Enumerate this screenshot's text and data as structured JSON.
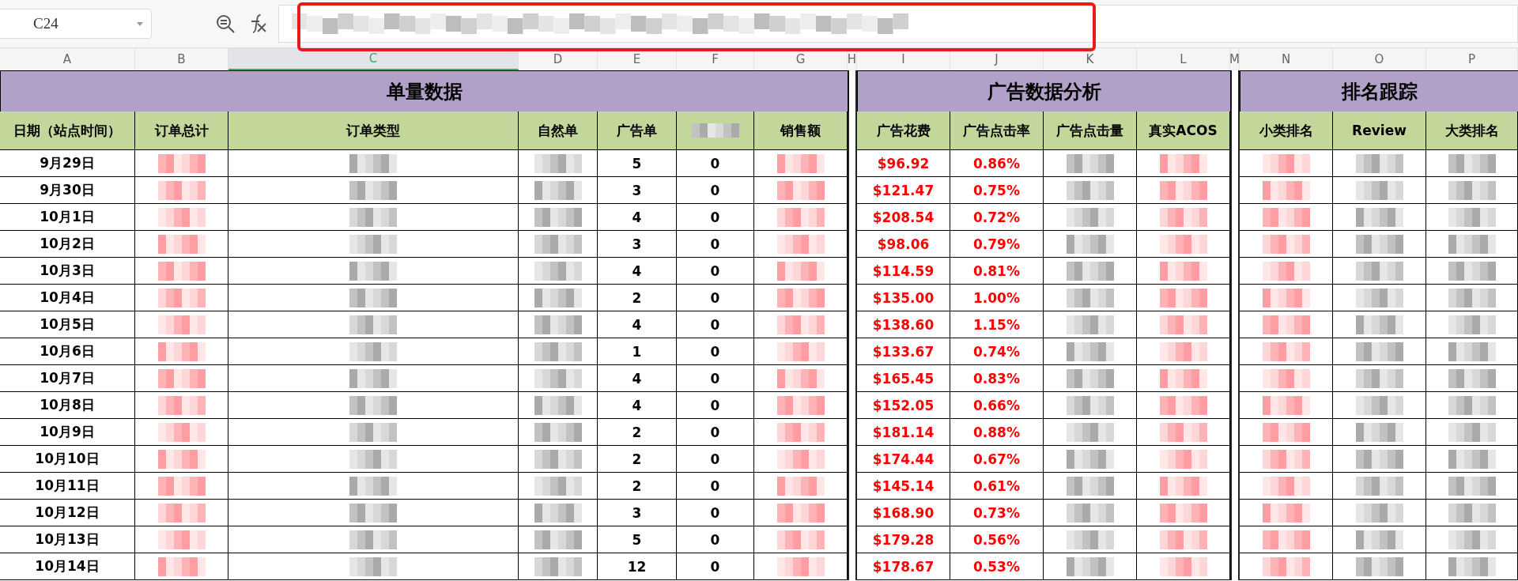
{
  "name_box": {
    "value": "C24"
  },
  "column_letters": [
    {
      "label": "A",
      "selected": false
    },
    {
      "label": "B",
      "selected": false
    },
    {
      "label": "C",
      "selected": true
    },
    {
      "label": "D",
      "selected": false
    },
    {
      "label": "E",
      "selected": false
    },
    {
      "label": "F",
      "selected": false
    },
    {
      "label": "G",
      "selected": false
    },
    {
      "label": "H",
      "selected": false
    },
    {
      "label": "I",
      "selected": false
    },
    {
      "label": "J",
      "selected": false
    },
    {
      "label": "K",
      "selected": false
    },
    {
      "label": "L",
      "selected": false
    },
    {
      "label": "M",
      "selected": false
    },
    {
      "label": "N",
      "selected": false
    },
    {
      "label": "O",
      "selected": false
    },
    {
      "label": "P",
      "selected": false
    }
  ],
  "sections": [
    {
      "title": "单量数据"
    },
    {
      "title": "广告数据分析"
    },
    {
      "title": "排名跟踪"
    }
  ],
  "headers": [
    {
      "label": "日期（站点时间）"
    },
    {
      "label": "订单总计"
    },
    {
      "label": "订单类型"
    },
    {
      "label": "自然单"
    },
    {
      "label": "广告单"
    },
    {
      "kind": "redacted"
    },
    {
      "label": "销售额"
    },
    {
      "label": "广告花费"
    },
    {
      "label": "广告点击率"
    },
    {
      "label": "广告点击量"
    },
    {
      "label": "真实ACOS"
    },
    {
      "label": "小类排名"
    },
    {
      "label": "Review"
    },
    {
      "label": "大类排名"
    }
  ],
  "rows": [
    {
      "date": "9月29日",
      "ad_orders": "5",
      "column_6": "0",
      "ad_spend": "$96.92",
      "ctr": "0.86%"
    },
    {
      "date": "9月30日",
      "ad_orders": "3",
      "column_6": "0",
      "ad_spend": "$121.47",
      "ctr": "0.75%"
    },
    {
      "date": "10月1日",
      "ad_orders": "4",
      "column_6": "0",
      "ad_spend": "$208.54",
      "ctr": "0.72%"
    },
    {
      "date": "10月2日",
      "ad_orders": "3",
      "column_6": "0",
      "ad_spend": "$98.06",
      "ctr": "0.79%"
    },
    {
      "date": "10月3日",
      "ad_orders": "4",
      "column_6": "0",
      "ad_spend": "$114.59",
      "ctr": "0.81%"
    },
    {
      "date": "10月4日",
      "ad_orders": "2",
      "column_6": "0",
      "ad_spend": "$135.00",
      "ctr": "1.00%"
    },
    {
      "date": "10月5日",
      "ad_orders": "4",
      "column_6": "0",
      "ad_spend": "$138.60",
      "ctr": "1.15%"
    },
    {
      "date": "10月6日",
      "ad_orders": "1",
      "column_6": "0",
      "ad_spend": "$133.67",
      "ctr": "0.74%"
    },
    {
      "date": "10月7日",
      "ad_orders": "4",
      "column_6": "0",
      "ad_spend": "$165.45",
      "ctr": "0.83%"
    },
    {
      "date": "10月8日",
      "ad_orders": "4",
      "column_6": "0",
      "ad_spend": "$152.05",
      "ctr": "0.66%"
    },
    {
      "date": "10月9日",
      "ad_orders": "2",
      "column_6": "0",
      "ad_spend": "$181.14",
      "ctr": "0.88%"
    },
    {
      "date": "10月10日",
      "ad_orders": "2",
      "column_6": "0",
      "ad_spend": "$174.44",
      "ctr": "0.67%"
    },
    {
      "date": "10月11日",
      "ad_orders": "2",
      "column_6": "0",
      "ad_spend": "$145.14",
      "ctr": "0.61%"
    },
    {
      "date": "10月12日",
      "ad_orders": "3",
      "column_6": "0",
      "ad_spend": "$168.90",
      "ctr": "0.73%"
    },
    {
      "date": "10月13日",
      "ad_orders": "5",
      "column_6": "0",
      "ad_spend": "$179.28",
      "ctr": "0.56%"
    },
    {
      "date": "10月14日",
      "ad_orders": "12",
      "column_6": "0",
      "ad_spend": "$178.67",
      "ctr": "0.53%"
    }
  ]
}
